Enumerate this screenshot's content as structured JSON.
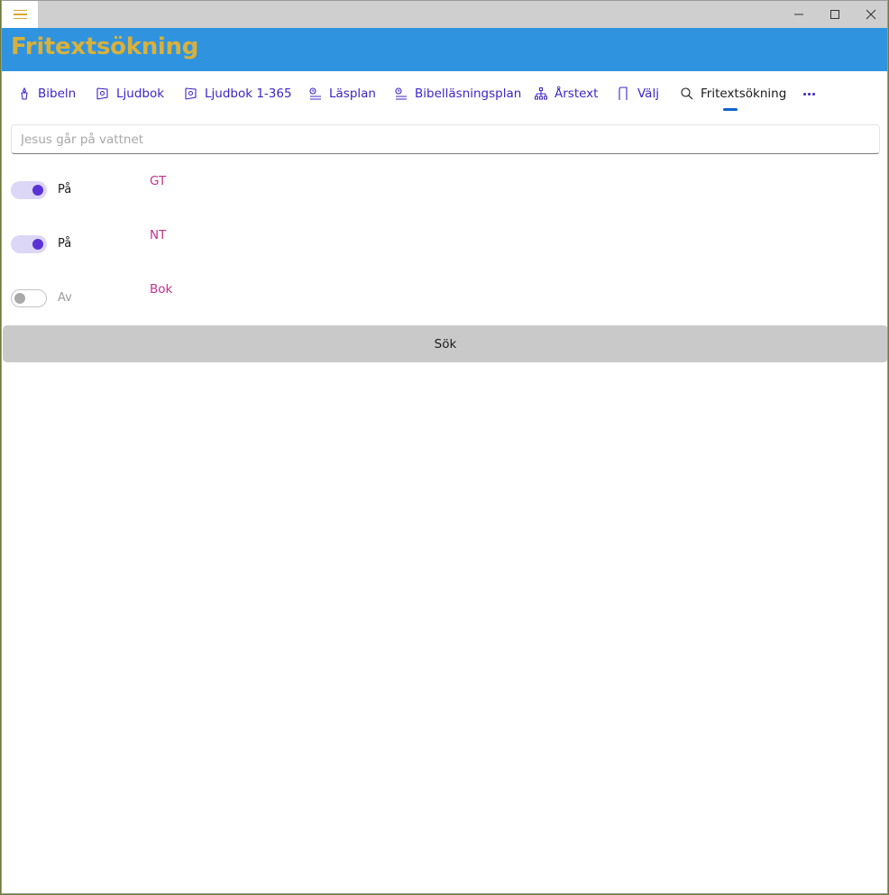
{
  "window": {
    "title": "Fritextsökning",
    "controls": {
      "minimize": "minimize-icon",
      "maximize": "maximize-icon",
      "close": "close-icon"
    }
  },
  "tabs": [
    {
      "label": "Bibeln",
      "icon": "bible-icon"
    },
    {
      "label": "Ljudbok",
      "icon": "audiobook-icon"
    },
    {
      "label": "Ljudbok 1-365",
      "icon": "audiobook-icon"
    },
    {
      "label": "Läsplan",
      "icon": "reading-plan-icon"
    },
    {
      "label": "Bibelläsningsplan",
      "icon": "reading-plan-icon"
    },
    {
      "label": "Årstext",
      "icon": "hierarchy-icon"
    },
    {
      "label": "Välj",
      "icon": "bookmark-icon"
    },
    {
      "label": "Fritextsökning",
      "icon": "search-icon",
      "selected": true
    }
  ],
  "search": {
    "placeholder": "Jesus går på vattnet",
    "value": ""
  },
  "filters": [
    {
      "state": "on",
      "state_label": "På",
      "category": "GT"
    },
    {
      "state": "on",
      "state_label": "På",
      "category": "NT"
    },
    {
      "state": "off",
      "state_label": "Av",
      "category": "Bok"
    }
  ],
  "search_button": {
    "label": "Sök"
  },
  "colors": {
    "titlebar": "#cfcfcf",
    "appbar": "#2f93e0",
    "title_text": "#d8b13a",
    "tab_text": "#3c26c9",
    "category_text": "#c0328f",
    "toggle_on_track": "#dcd6f7",
    "toggle_on_knob": "#5a33d6",
    "button_bg": "#c9c9c9"
  }
}
